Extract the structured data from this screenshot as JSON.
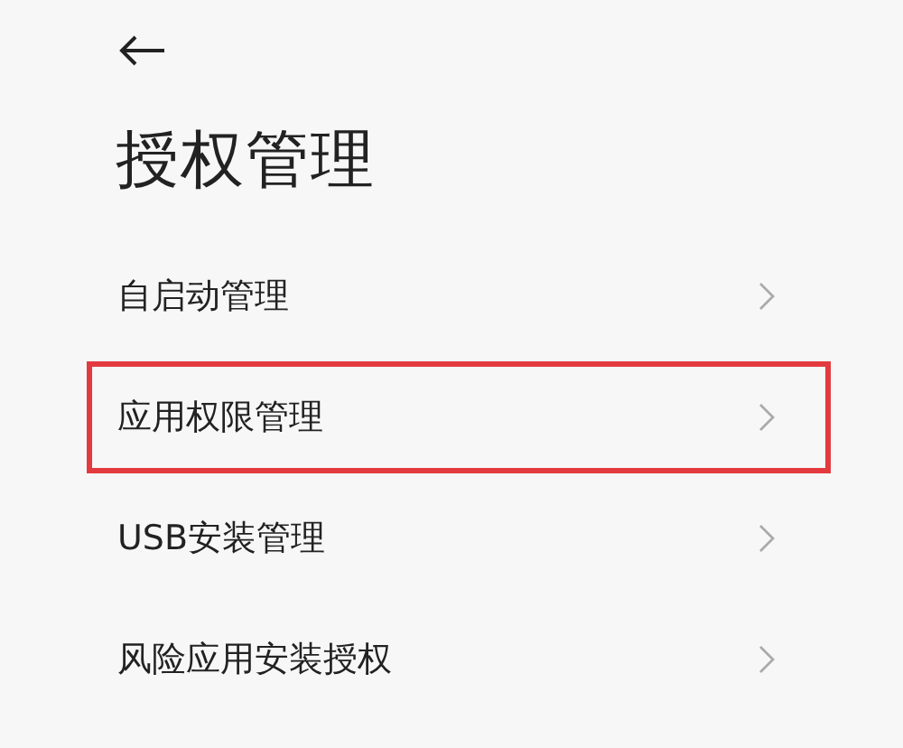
{
  "header": {
    "title": "授权管理"
  },
  "items": [
    {
      "label": "自启动管理",
      "highlighted": false
    },
    {
      "label": "应用权限管理",
      "highlighted": true
    },
    {
      "label": "USB安装管理",
      "highlighted": false
    },
    {
      "label": "风险应用安装授权",
      "highlighted": false
    }
  ]
}
